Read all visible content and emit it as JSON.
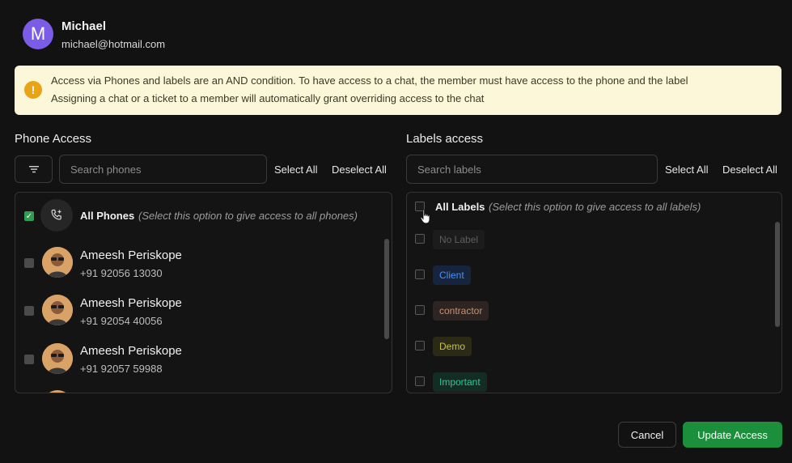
{
  "user": {
    "initial": "M",
    "name": "Michael",
    "email": "michael@hotmail.com"
  },
  "banner": {
    "line1": "Access via Phones and labels are an AND condition. To have access to a chat, the member must have access to the phone and the label",
    "line2": "Assigning a chat or a ticket to a member will automatically grant overriding access to the chat",
    "icon": "info-icon"
  },
  "phone_access": {
    "title": "Phone Access",
    "search_placeholder": "Search phones",
    "select_all": "Select All",
    "deselect_all": "Deselect All",
    "all_option": {
      "label": "All Phones",
      "hint": "(Select this option to give access to all phones)",
      "checked": true
    },
    "phones": [
      {
        "name": "Ameesh Periskope",
        "number": "+91 92056 13030"
      },
      {
        "name": "Ameesh Periskope",
        "number": "+91 92054 40056"
      },
      {
        "name": "Ameesh Periskope",
        "number": "+91 92057 59988"
      }
    ]
  },
  "labels_access": {
    "title": "Labels access",
    "search_placeholder": "Search labels",
    "select_all": "Select All",
    "deselect_all": "Deselect All",
    "all_option": {
      "label": "All Labels",
      "hint": "(Select this option to give access to all labels)",
      "checked": false
    },
    "labels": [
      {
        "name": "No Label",
        "color": "#5e5e5e",
        "bg": "#1c1c1c"
      },
      {
        "name": "Client",
        "color": "#4b8ff0",
        "bg": "#16253d"
      },
      {
        "name": "contractor",
        "color": "#c4917a",
        "bg": "#2e2421"
      },
      {
        "name": "Demo",
        "color": "#c8c24a",
        "bg": "#2a2a17"
      },
      {
        "name": "Important",
        "color": "#33c48f",
        "bg": "#132d24"
      }
    ]
  },
  "footer": {
    "cancel": "Cancel",
    "update": "Update Access"
  },
  "colors": {
    "accent": "#1c8f3c",
    "avatar": "#7b5ce6",
    "banner_bg": "#fbf7d8",
    "info_icon": "#e8a317"
  }
}
